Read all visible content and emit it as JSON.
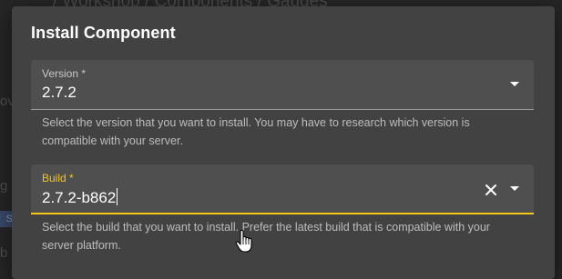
{
  "background": {
    "breadcrumb": "/  Workshop  /  Components  /  Gauges",
    "fragment_1": "ov",
    "fragment_2": "g",
    "tag": "S",
    "fragment_3": "b"
  },
  "dialog": {
    "title": "Install Component",
    "version": {
      "label": "Version *",
      "value": "2.7.2",
      "hint": "Select the version that you want to install. You may have to research which version is compatible with your server."
    },
    "build": {
      "label": "Build *",
      "value": "2.7.2-b862",
      "hint": "Select the build that you want to install. Prefer the latest build that is compatible with your server platform."
    }
  },
  "colors": {
    "dialog_bg": "#424242",
    "field_bg": "#4f4f4f",
    "accent": "#f5c518",
    "text": "#ffffff",
    "hint_text": "#bdbdbd"
  },
  "icons": {
    "version_dropdown": "arrow-drop-down-icon",
    "build_clear": "close-icon",
    "build_dropdown": "arrow-drop-down-icon",
    "mouse_cursor": "hand-pointer-icon"
  }
}
